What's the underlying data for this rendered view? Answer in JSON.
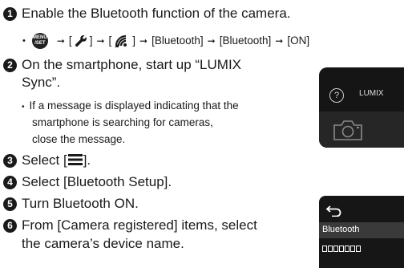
{
  "steps": [
    {
      "num": "1",
      "text": "Enable the Bluetooth function of the camera."
    },
    {
      "num": "2",
      "line1": "On the smartphone, start up “LUMIX",
      "line2": "Sync”."
    },
    {
      "num": "3",
      "before": "Select [",
      "after": "]."
    },
    {
      "num": "4",
      "text": "Select [Bluetooth Setup]."
    },
    {
      "num": "5",
      "text": "Turn Bluetooth ON."
    },
    {
      "num": "6",
      "line1": "From [Camera registered] items, select",
      "line2": "the camera’s device name."
    }
  ],
  "path": {
    "bullet": "•",
    "menu_btn_top": "MENU",
    "menu_btn_bottom": "/SET",
    "arrow": "➞",
    "item1": "[Bluetooth]",
    "item2": "[Bluetooth]",
    "item3": "[ON]"
  },
  "note": {
    "bullet": "•",
    "lines": [
      "If a message is displayed indicating that the",
      "smartphone is searching for cameras,",
      "close the message."
    ]
  },
  "phone1": {
    "help": "?",
    "app_name": "LUMIX"
  },
  "phone2": {
    "label": "Bluetooth"
  },
  "icons": [
    "menu-set-button-icon",
    "wrench-icon",
    "wifi-bluetooth-icon",
    "hamburger-menu-icon",
    "camera-icon",
    "back-arrow-icon"
  ]
}
